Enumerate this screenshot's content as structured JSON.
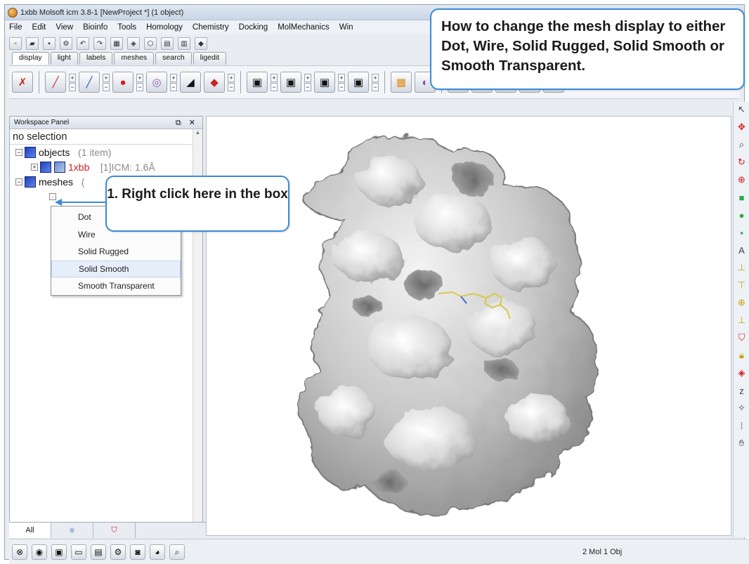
{
  "window": {
    "title": "1xbb Molsoft icm 3.8-1  [NewProject *] (1 object)"
  },
  "menu": [
    "File",
    "Edit",
    "View",
    "Bioinfo",
    "Tools",
    "Homology",
    "Chemistry",
    "Docking",
    "MolMechanics",
    "Win"
  ],
  "toolbar_tabs": [
    "display",
    "light",
    "labels",
    "meshes",
    "search",
    "ligedit"
  ],
  "workspace": {
    "title": "Workspace Panel",
    "selection": "no selection",
    "objects": {
      "label": "objects",
      "count": "(1 item)"
    },
    "object_item": {
      "name": "1xbb",
      "detail": "[1]ICM: 1.6Å"
    },
    "meshes": {
      "label": "meshes",
      "count": "("
    }
  },
  "context_menu": {
    "items": [
      "Dot",
      "Wire",
      "Solid Rugged",
      "Solid Smooth",
      "Smooth Transparent"
    ],
    "highlighted": "Solid Smooth"
  },
  "callouts": {
    "step1": "1. Right click here in the box",
    "title": "How to change the mesh display to either Dot, Wire, Solid Rugged, Solid Smooth or Smooth Transparent."
  },
  "bottom_tabs": [
    "All"
  ],
  "status": {
    "text": "2 Mol 1 Obj"
  },
  "colors": {
    "accent": "#3b8bd8",
    "object_red": "#d42020",
    "mesh_node": "#2240b8"
  }
}
